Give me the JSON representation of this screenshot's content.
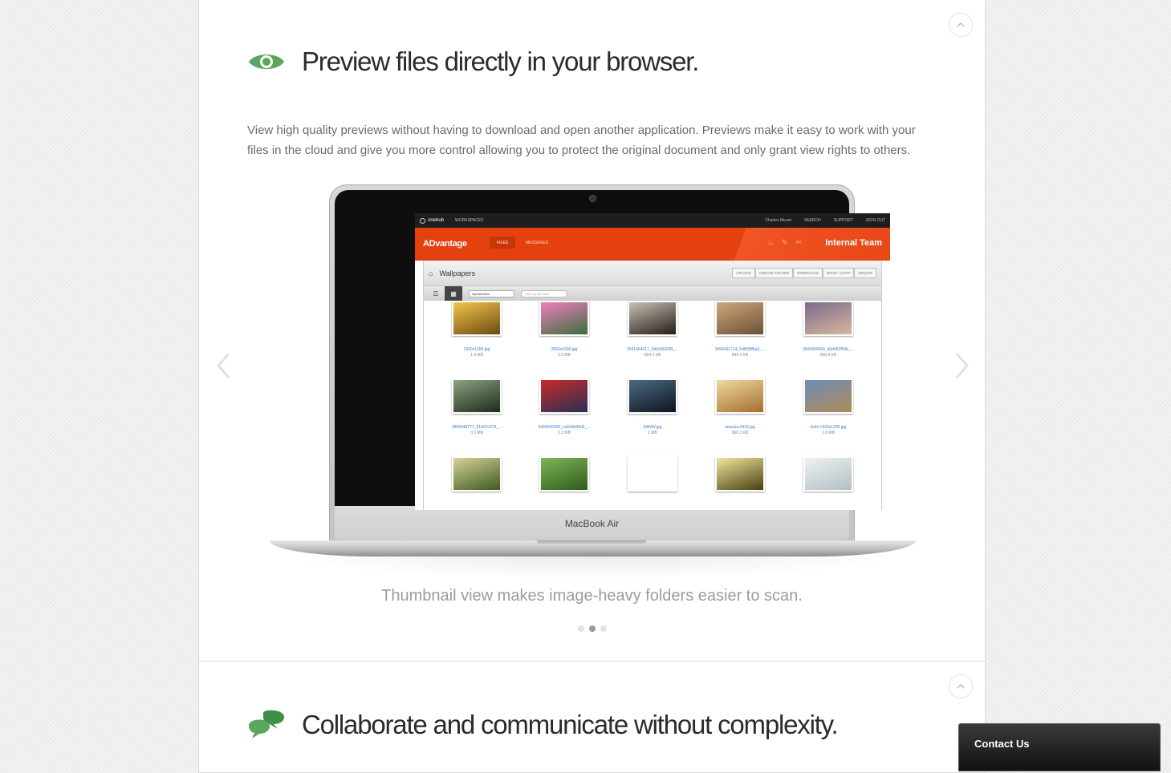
{
  "section1": {
    "title": "Preview files directly in your browser.",
    "description": "View high quality previews without having to download and open another application. Previews make it easy to work with your files in the cloud and give you more control allowing you to protect the original document and only grant view rights to others.",
    "icon": "eye-icon",
    "caption": "Thumbnail view makes image-heavy folders easier to scan.",
    "slides": 3,
    "active_slide": 2
  },
  "section2": {
    "title": "Collaborate and communicate without complexity.",
    "icon": "chat-bubbles-icon"
  },
  "contact": {
    "label": "Contact Us"
  },
  "laptop": {
    "brand": "MacBook Air",
    "app": {
      "logo": "onehub",
      "workspaces": "WORKSPACES",
      "user": "Charles Mount",
      "search": "SEARCH",
      "support": "SUPPORT",
      "signout": "SIGN OUT",
      "workspace_name": "ADvantage",
      "tab_files": "FILES",
      "tab_messages": "MESSAGES",
      "team": "Internal Team",
      "folder": "Wallpapers",
      "actions": [
        "UPLOAD",
        "CREATE FOLDER",
        "DOWNLOAD",
        "MOVE / COPY",
        "DELETE"
      ],
      "sort": "Alphabetical",
      "filter_placeholder": "Filter by filename",
      "files": [
        {
          "name": "1920x1200.jpg",
          "size": "1.4 MB",
          "colors": [
            "#f3c64a",
            "#6b4a12"
          ]
        },
        {
          "name": "2560x1600.jpg",
          "size": "3.5 MB",
          "colors": [
            "#ef7fc0",
            "#3d6e3a"
          ]
        },
        {
          "name": "2651464017_3db536928f_...",
          "size": "684.2 KB",
          "colors": [
            "#c9c1b6",
            "#241d17"
          ]
        },
        {
          "name": "3494431714_5d8f3f85a3_...",
          "size": "689.4 KB",
          "colors": [
            "#d0a67c",
            "#6b5136"
          ]
        },
        {
          "name": "3500989490_d0d453f50b_...",
          "size": "566.9 KB",
          "colors": [
            "#7b6a8e",
            "#d8b79c"
          ]
        },
        {
          "name": "3958448777_51407cf72f_...",
          "size": "3.3 MB",
          "colors": [
            "#8aa37e",
            "#1d2a1d"
          ]
        },
        {
          "name": "4394042465_ca54dd49d2_...",
          "size": "3.2 MB",
          "colors": [
            "#c62b2a",
            "#2a2f55"
          ]
        },
        {
          "name": "DANW.jpg",
          "size": "1 MB",
          "colors": [
            "#4b6a85",
            "#0d141f"
          ]
        },
        {
          "name": "delusion1920.jpg",
          "size": "960.3 KB",
          "colors": [
            "#f1d8a2",
            "#a36e2e"
          ]
        },
        {
          "name": "Gold 1920x1200.jpg",
          "size": "1.6 MB",
          "colors": [
            "#6c8db8",
            "#b18b55"
          ]
        },
        {
          "name": "",
          "size": "",
          "colors": [
            "#d8d39a",
            "#3d5a1e"
          ]
        },
        {
          "name": "",
          "size": "",
          "colors": [
            "#7fb55a",
            "#2f5b1b"
          ]
        },
        {
          "name": "",
          "size": "",
          "colors": [
            "#ffffff",
            "#ffffff"
          ]
        },
        {
          "name": "",
          "size": "",
          "colors": [
            "#f0e8a0",
            "#4a4010"
          ]
        },
        {
          "name": "",
          "size": "",
          "colors": [
            "#eef1f2",
            "#b2c0c6"
          ]
        }
      ]
    }
  },
  "colors": {
    "accent_green": "#5aa65c",
    "app_orange": "#e4410f"
  }
}
